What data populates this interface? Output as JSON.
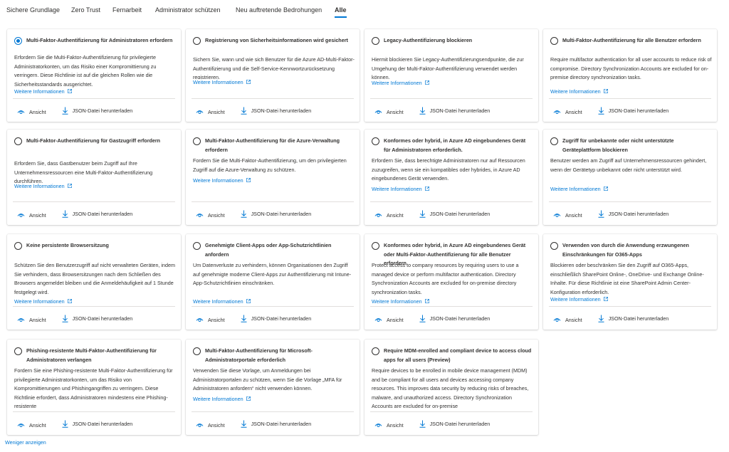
{
  "tabs": [
    {
      "label": "Sichere Grundlage"
    },
    {
      "label": "Zero Trust"
    },
    {
      "label": "Fernarbeit"
    },
    {
      "label": "Administrator schützen"
    },
    {
      "label": "Neu auftretende Bedrohungen"
    },
    {
      "label": "Alle",
      "active": true
    }
  ],
  "common": {
    "more_label": "Weitere Informationen",
    "view_label": "Ansicht",
    "download_label": "JSON-Datei herunterladen"
  },
  "cards": [
    {
      "title": "Multi-Faktor-Authentifizierung für Administratoren erfordern",
      "selected": true,
      "description": "Erfordern Sie die Multi-Faktor-Authentifizierung für privilegierte Administratorkonten, um das Risiko einer Kompromittierung zu verringern. Diese Richtlinie ist auf die gleichen Rollen wie die Sicherheitsstandards ausgerichtet."
    },
    {
      "title": "Registrierung von Sicherheitsinformationen wird gesichert",
      "description": "Sichern Sie, wann und wie sich Benutzer für die Azure AD-Multi-Faktor-Authentifizierung und die Self-Service-Kennwortzurücksetzung registrieren."
    },
    {
      "title": "Legacy-Authentifizierung blockieren",
      "description": "Hiermit blockieren Sie Legacy-Authentifizierungsendpunkte, die zur Umgehung der Multi-Faktor-Authentifizierung verwendet werden können."
    },
    {
      "title": "Multi-Faktor-Authentifizierung für alle Benutzer erfordern",
      "description": "Require multifactor authentication for all user accounts to reduce risk of compromise. Directory Synchronization Accounts are excluded for on-premise directory synchronization tasks."
    },
    {
      "title": "Multi-Faktor-Authentifizierung für Gastzugriff erfordern",
      "description": "Erfordern Sie, dass Gastbenutzer beim Zugriff auf Ihre Unternehmensressourcen eine Multi-Faktor-Authentifizierung durchführen."
    },
    {
      "title": "Multi-Faktor-Authentifizierung für die Azure-Verwaltung erfordern",
      "description": "Fordern Sie die Multi-Faktor-Authentifizierung, um den privilegierten Zugriff auf die Azure-Verwaltung zu schützen."
    },
    {
      "title": "Konformes oder hybrid, in Azure AD eingebundenes Gerät für Administratoren erforderlich.",
      "description": "Erfordern Sie, dass berechtigte Administratoren nur auf Ressourcen zuzugreifen, wenn sie ein kompatibles oder hybrides, in Azure AD eingebundenes Gerät verwenden."
    },
    {
      "title": "Zugriff für unbekannte oder nicht unterstützte Geräteplattform blockieren",
      "description": "Benutzer werden am Zugriff auf Unternehmensressourcen gehindert, wenn der Gerätetyp unbekannt oder nicht unterstützt wird."
    },
    {
      "title": "Keine persistente Browsersitzung",
      "description": "Schützen Sie den Benutzerzugriff auf nicht verwalteten Geräten, indem Sie verhindern, dass Browsersitzungen nach dem Schließen des Browsers angemeldet bleiben und die Anmeldehäufigkeit auf 1 Stunde festgelegt wird."
    },
    {
      "title": "Genehmigte Client-Apps oder App-Schutzrichtlinien anfordern",
      "description": "Um Datenverluste zu verhindern, können Organisationen den Zugriff auf genehmigte moderne Client-Apps zur Authentifizierung mit Intune-App-Schutzrichtlinien einschränken."
    },
    {
      "title": "Konformes oder hybrid, in Azure AD eingebundenes Gerät oder Multi-Faktor-Authentifizierung für alle Benutzer erfordern",
      "description": "Protect access to company resources by requiring users to use a managed device or perform multifactor authentication. Directory Synchronization Accounts are excluded for on-premise directory synchronization tasks."
    },
    {
      "title": "Verwenden von durch die Anwendung erzwungenen Einschränkungen für O365-Apps",
      "description": "Blockieren oder beschränken Sie den Zugriff auf O365-Apps, einschließlich SharePoint Online-, OneDrive- und Exchange Online-Inhalte. Für diese Richtlinie ist eine SharePoint Admin Center-Konfiguration erforderlich."
    },
    {
      "title": "Phishing-resistente Multi-Faktor-Authentifizierung für Administratoren verlangen",
      "description": "Fordern Sie eine Phishing-resistente Multi-Faktor-Authentifizierung für privilegierte Administratorkonten, um das Risiko von Kompromittierungen und Phishingangriffen zu verringern. Diese Richtlinie erfordert, dass Administratoren mindestens eine Phishing-resistente"
    },
    {
      "title": "Multi-Faktor-Authentifizierung für Microsoft-Administratorportale erforderlich",
      "description": "Verwenden Sie diese Vorlage, um Anmeldungen bei Administratorportalen zu schützen, wenn Sie die Vorlage „MFA für Administratoren anfordern“ nicht verwenden können."
    },
    {
      "title": "Require MDM-enrolled and compliant device to access cloud apps for all users (Preview)",
      "description": "Require devices to be enrolled in mobile device management (MDM) and be compliant for all users and devices accessing company resources. This improves data security by reducing risks of breaches, malware, and unauthorized access. Directory Synchronization Accounts are excluded for on-premise"
    }
  ],
  "footer": {
    "show_less_label": "Weniger anzeigen"
  }
}
